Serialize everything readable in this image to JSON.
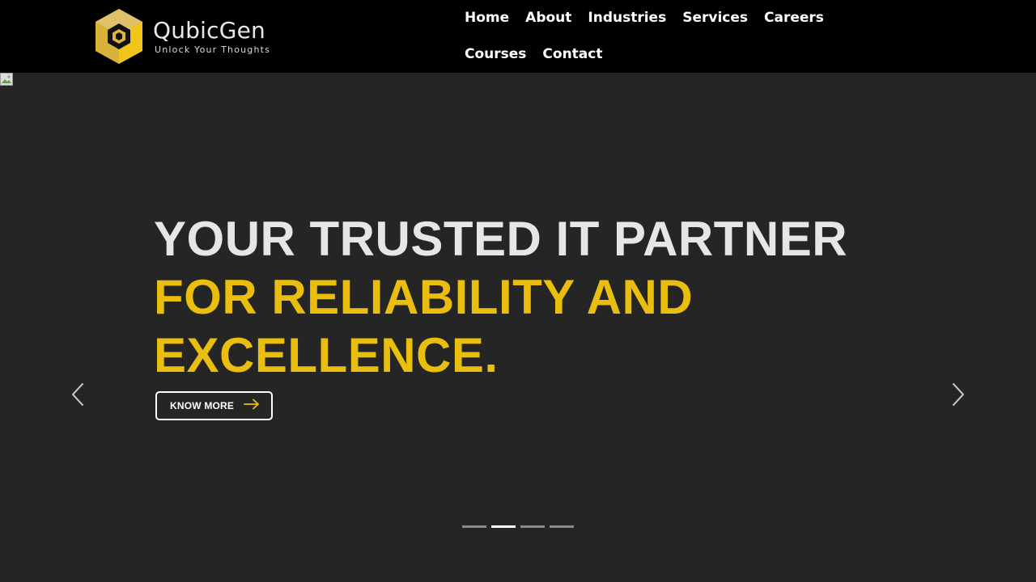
{
  "brand": {
    "name": "QubicGen",
    "tagline": "Unlock Your Thoughts",
    "accent_color": "#e9be0e"
  },
  "nav": {
    "items": [
      {
        "label": "Home"
      },
      {
        "label": "About"
      },
      {
        "label": "Industries"
      },
      {
        "label": "Services"
      },
      {
        "label": "Careers"
      },
      {
        "label": "Courses"
      },
      {
        "label": "Contact"
      }
    ]
  },
  "hero": {
    "headline_line1": "YOUR TRUSTED IT PARTNER",
    "headline_line2": "FOR RELIABILITY AND EXCELLENCE.",
    "cta_label": "KNOW MORE",
    "prev_icon": "chevron-left-icon",
    "next_icon": "chevron-right-icon",
    "slide_count": 4,
    "active_slide": 2
  }
}
